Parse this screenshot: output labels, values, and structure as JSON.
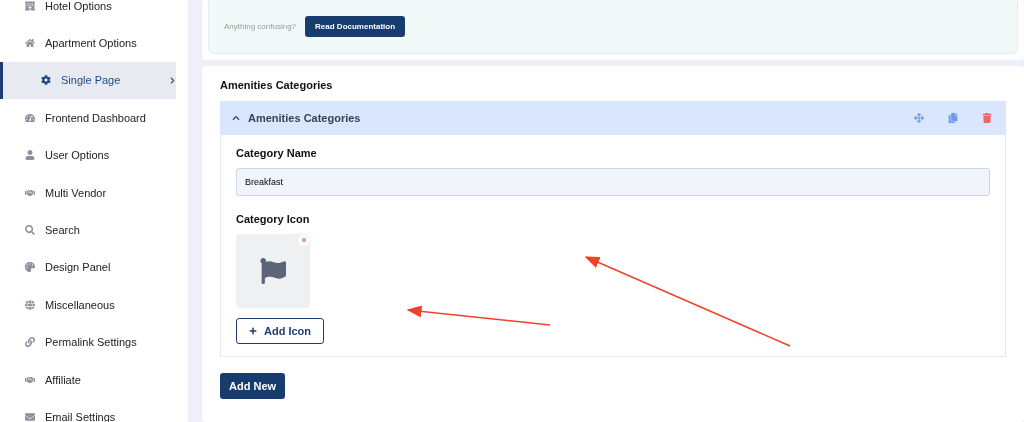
{
  "sidebar": {
    "items": [
      {
        "label": "Hotel Options",
        "selected": false
      },
      {
        "label": "Apartment Options",
        "selected": false
      },
      {
        "label": "Single Page",
        "selected": true
      },
      {
        "label": "Frontend Dashboard",
        "selected": false
      },
      {
        "label": "User Options",
        "selected": false
      },
      {
        "label": "Multi Vendor",
        "selected": false
      },
      {
        "label": "Search",
        "selected": false
      },
      {
        "label": "Design Panel",
        "selected": false
      },
      {
        "label": "Miscellaneous",
        "selected": false
      },
      {
        "label": "Permalink Settings",
        "selected": false
      },
      {
        "label": "Affiliate",
        "selected": false
      },
      {
        "label": "Email Settings",
        "selected": false
      }
    ]
  },
  "help": {
    "text": "Anything confusing?",
    "button": "Read Documentation"
  },
  "section": {
    "title": "Amenities Categories",
    "repeater": {
      "title": "Amenities Categories",
      "expanded": true,
      "fields": {
        "name_label": "Category Name",
        "name_value": "Breakfast",
        "icon_label": "Category Icon",
        "add_icon": "Add Icon"
      }
    },
    "add_new": "Add New"
  }
}
